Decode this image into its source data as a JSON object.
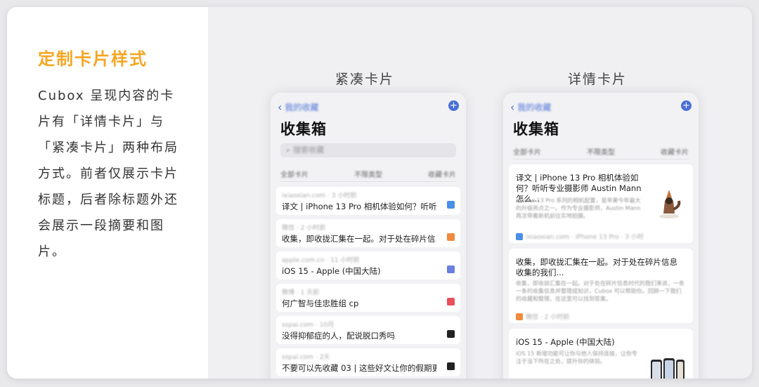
{
  "left": {
    "title": "定制卡片样式",
    "description": "Cubox 呈现内容的卡片有「详情卡片」与「紧凑卡片」两种布局方式。前者仅展示卡片标题，后者除标题外还会展示一段摘要和图片。"
  },
  "compact": {
    "label": "紧凑卡片",
    "nav_back": "我的收藏",
    "title": "收集箱",
    "search_placeholder": "搜索收藏",
    "filters": [
      "全部卡片",
      "不限类型",
      "收藏卡片"
    ],
    "cards": [
      {
        "meta": "ixiaoxian.com · 3 小时前",
        "title": "译文 | iPhone 13 Pro 相机体验如何？听听...",
        "icon_color": "#4a8fe8"
      },
      {
        "meta": "微信 · 2 小时前",
        "title": "收集，即收拢汇集在一起。对于处在碎片信...",
        "icon_color": "#f08a3e"
      },
      {
        "meta": "apple.com.cn · 11 小时前",
        "title": "iOS 15 - Apple (中国大陆)",
        "icon_color": "#6a7fe0"
      },
      {
        "meta": "微博 · 1 天前",
        "title": "何广智与佳忠胜组 cp",
        "icon_color": "#e8505b"
      },
      {
        "meta": "sspai.com · 10月",
        "title": "没得抑郁症的人，配说脱口秀吗",
        "icon_color": "#222222"
      },
      {
        "meta": "sspai.com · 2天",
        "title": "不要可以先收藏 03 | 这些好文让你的假期更...",
        "icon_color": "#222222"
      }
    ]
  },
  "detail": {
    "label": "详情卡片",
    "nav_back": "我的收藏",
    "title": "收集箱",
    "filters": [
      "全部卡片",
      "不限类型",
      "收藏卡片"
    ],
    "cards": [
      {
        "title": "译文 | iPhone 13 Pro 相机体验如何？听听专业摄影师 Austin Mann 怎么...",
        "summary": "iPhone 13 Pro 系列的相机配置，是苹果今年最大的升级亮点之一。作为专业摄影师，Austin Mann 再次带着新机前往实地拍摄。",
        "footer": "ixiaoxian.com · iPhone 13 Pro · 3 小时",
        "icon_color": "#4a8fe8"
      },
      {
        "title": "收集，即收拢汇集在一起。对于处在碎片信息收集的我们...",
        "summary": "收集，即收拢汇集在一起。对于处在碎片信息时代的我们来说，一条一条的收集信息并整理成知识，Cubox 可以帮助你。回顾一下我们的收藏和整理，在这里可以找到答案。",
        "footer": "微信 · 2 小时前",
        "icon_color": "#f08a3e"
      },
      {
        "title": "iOS 15 - Apple (中国大陆)",
        "summary": "iOS 15 新增功能可让你与他人保持连接，让你专注于当下所在之处，提升你的体验。",
        "footer": "",
        "icon_color": "#6a7fe0"
      }
    ]
  },
  "colors": {
    "accent": "#f5a623",
    "link": "#4a6fd6"
  }
}
